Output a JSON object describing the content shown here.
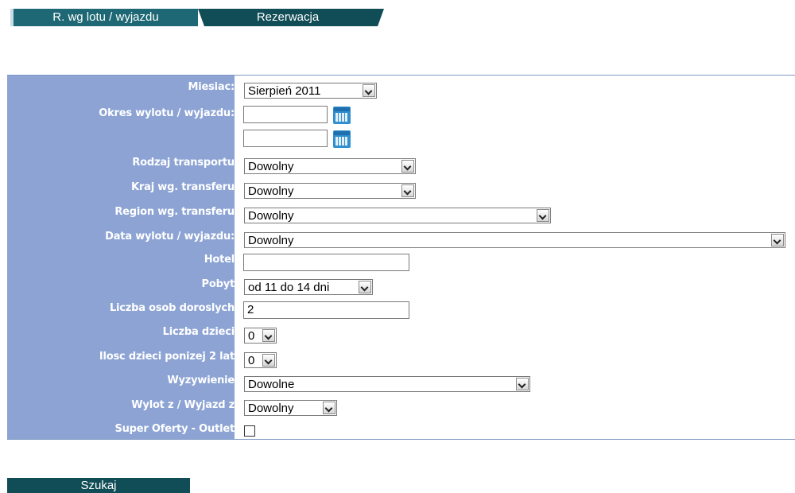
{
  "tabs": [
    {
      "label": "R. wg lotu / wyjazdu",
      "active": true
    },
    {
      "label": "Rezerwacja",
      "active": false
    }
  ],
  "colors": {
    "tab_dark": "#114d57",
    "label_column": "#8ca3d4",
    "border": "#7e98c6"
  },
  "form": {
    "miesiac": {
      "label": "Miesiac:",
      "value": "Sierpień 2011"
    },
    "okres": {
      "label": "Okres wylotu / wyjazdu:",
      "from": "",
      "to": "",
      "icon": "calendar-icon"
    },
    "transport": {
      "label": "Rodzaj transportu",
      "value": "Dowolny"
    },
    "kraj": {
      "label": "Kraj wg. transferu",
      "value": "Dowolny"
    },
    "region": {
      "label": "Region wg. transferu",
      "value": "Dowolny"
    },
    "data_wylotu": {
      "label": "Data wylotu / wyjazdu:",
      "value": "Dowolny"
    },
    "hotel": {
      "label": "Hotel",
      "value": ""
    },
    "pobyt": {
      "label": "Pobyt",
      "value": "od 11 do 14 dni"
    },
    "dorosli": {
      "label": "Liczba osob doroslych",
      "value": "2"
    },
    "dzieci": {
      "label": "Liczba dzieci",
      "value": "0"
    },
    "dzieci_2": {
      "label": "Ilosc dzieci ponizej 2 lat",
      "value": "0"
    },
    "wyzywienie": {
      "label": "Wyzywienie",
      "value": "Dowolne"
    },
    "wylot_z": {
      "label": "Wylot z / Wyjazd z",
      "value": "Dowolny"
    },
    "outlet": {
      "label": "Super Oferty - Outlet",
      "checked": false
    }
  },
  "search_button": {
    "label": "Szukaj"
  }
}
